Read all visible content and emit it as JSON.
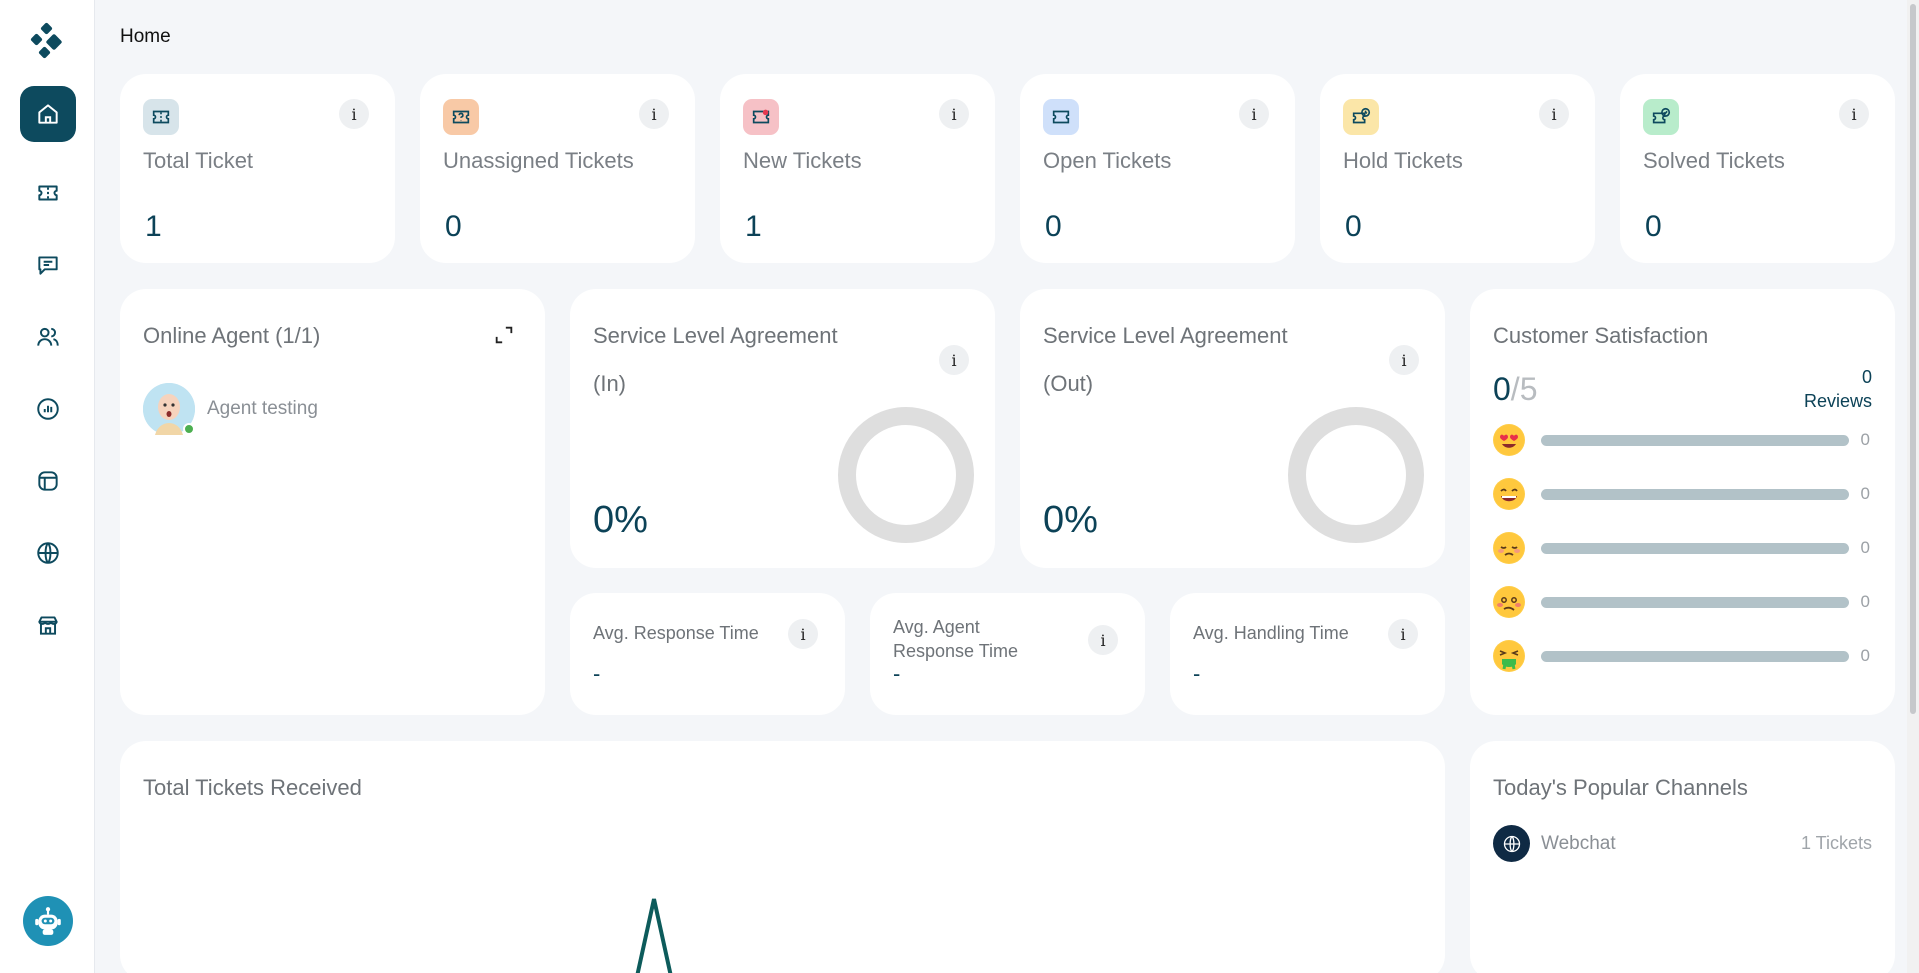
{
  "breadcrumb": "Home",
  "stats": [
    {
      "label": "Total Ticket",
      "value": "1",
      "icon": "ticket-icon",
      "color": "#d7e4ea"
    },
    {
      "label": "Unassigned Tickets",
      "value": "0",
      "icon": "ticket-question-icon",
      "color": "#f8c9a6"
    },
    {
      "label": "New Tickets",
      "value": "1",
      "icon": "ticket-new-icon",
      "color": "#f6c1c6"
    },
    {
      "label": "Open Tickets",
      "value": "0",
      "icon": "ticket-open-icon",
      "color": "#cfe0fa"
    },
    {
      "label": "Hold Tickets",
      "value": "0",
      "icon": "ticket-hold-icon",
      "color": "#fbe6a8"
    },
    {
      "label": "Solved Tickets",
      "value": "0",
      "icon": "ticket-solved-icon",
      "color": "#b8eccb"
    }
  ],
  "online_agent": {
    "title": "Online Agent (1/1)",
    "agents": [
      {
        "name": "Agent testing",
        "status": "online"
      }
    ]
  },
  "sla_in": {
    "title": "Service Level Agreement",
    "subtitle": "(In)",
    "value": "0%"
  },
  "sla_out": {
    "title": "Service Level Agreement",
    "subtitle": "(Out)",
    "value": "0%"
  },
  "avg_response": {
    "title": "Avg. Response Time",
    "value": "-"
  },
  "avg_agent_response": {
    "title_line1": "Avg. Agent",
    "title_line2": "Response Time",
    "value": "-"
  },
  "avg_handling": {
    "title": "Avg. Handling Time",
    "value": "-"
  },
  "customer_satisfaction": {
    "title": "Customer Satisfaction",
    "score": "0",
    "out_of": "/5",
    "reviews_count": "0",
    "reviews_label": "Reviews",
    "ratings": [
      {
        "emoji": "heart-eyes-face-icon",
        "count": "0"
      },
      {
        "emoji": "grinning-face-icon",
        "count": "0"
      },
      {
        "emoji": "pensive-face-icon",
        "count": "0"
      },
      {
        "emoji": "woozy-face-icon",
        "count": "0"
      },
      {
        "emoji": "vomiting-face-icon",
        "count": "0"
      }
    ]
  },
  "tickets_received": {
    "title": "Total Tickets Received"
  },
  "popular_channels": {
    "title": "Today's Popular Channels",
    "channels": [
      {
        "name": "Webchat",
        "count": "1 Tickets",
        "icon": "globe-icon"
      }
    ]
  },
  "colors": {
    "primary": "#0d4a5e",
    "accent": "#1f91b5",
    "chart_line": "#0d5b5b",
    "ring": "#dedede"
  }
}
